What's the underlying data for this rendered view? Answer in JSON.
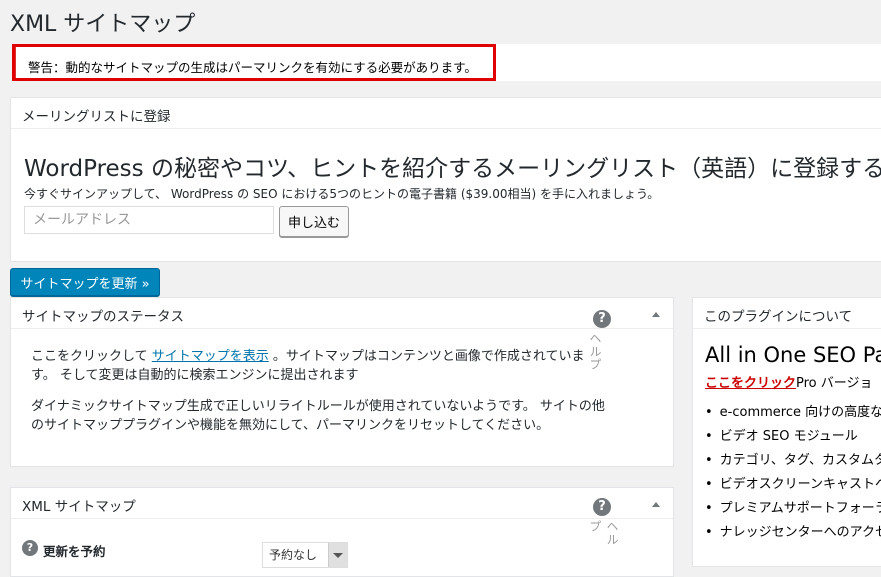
{
  "page": {
    "title": "XML サイトマップ"
  },
  "notice": {
    "text": "警告：動的なサイトマップの生成はパーマリンクを有効にする必要があります。"
  },
  "mailing": {
    "panel_title": "メーリングリストに登録",
    "headline": "WordPress の秘密やコツ、ヒントを紹介するメーリングリスト（英語）に登録する。",
    "subtext": "今すぐサインアップして、 WordPress の SEO における5つのヒントの電子書籍 ($39.00相当) を手に入れましょう。",
    "email_placeholder": "メールアドレス",
    "email_value": "",
    "subscribe_label": "申し込む"
  },
  "update_button": {
    "label": "サイトマップを更新 »"
  },
  "status_panel": {
    "title": "サイトマップのステータス",
    "help_text": "ヘルプ",
    "para1_pre": "ここをクリックして ",
    "para1_link": "サイトマップを表示",
    "para1_post": " 。サイトマップはコンテンツと画像で作成されていま",
    "para1_line2": "す。 そして変更は自動的に検索エンジンに提出されます",
    "para2_line1": "ダイナミックサイトマップ生成で正しいリライトルールが使用されていないようです。 サイトの他",
    "para2_line2": "のサイトマッププラグインや機能を無効にして、パーマリンクをリセットしてください。"
  },
  "about_panel": {
    "title": "このプラグインについて",
    "heading": "All in One SEO Pa",
    "link_text": "ここをクリック",
    "link_suffix": "Pro バージョ",
    "features": [
      "e-commerce 向けの高度なサ",
      "ビデオ SEO モジュール",
      "カテゴリ、タグ、カスタムタ",
      "ビデオスクリーンキャストへ",
      "プレミアムサポートフォーラ",
      "ナレッジセンターへのアクセ"
    ]
  },
  "xml_panel": {
    "title": "XML サイトマップ",
    "help_text": "ヘルプ",
    "schedule_label": "更新を予約",
    "schedule_value": "予約なし"
  },
  "colors": {
    "primary_button": "#0085ba",
    "warning_frame": "#e00000",
    "link": "#0073aa",
    "about_link": "#cc0000"
  }
}
